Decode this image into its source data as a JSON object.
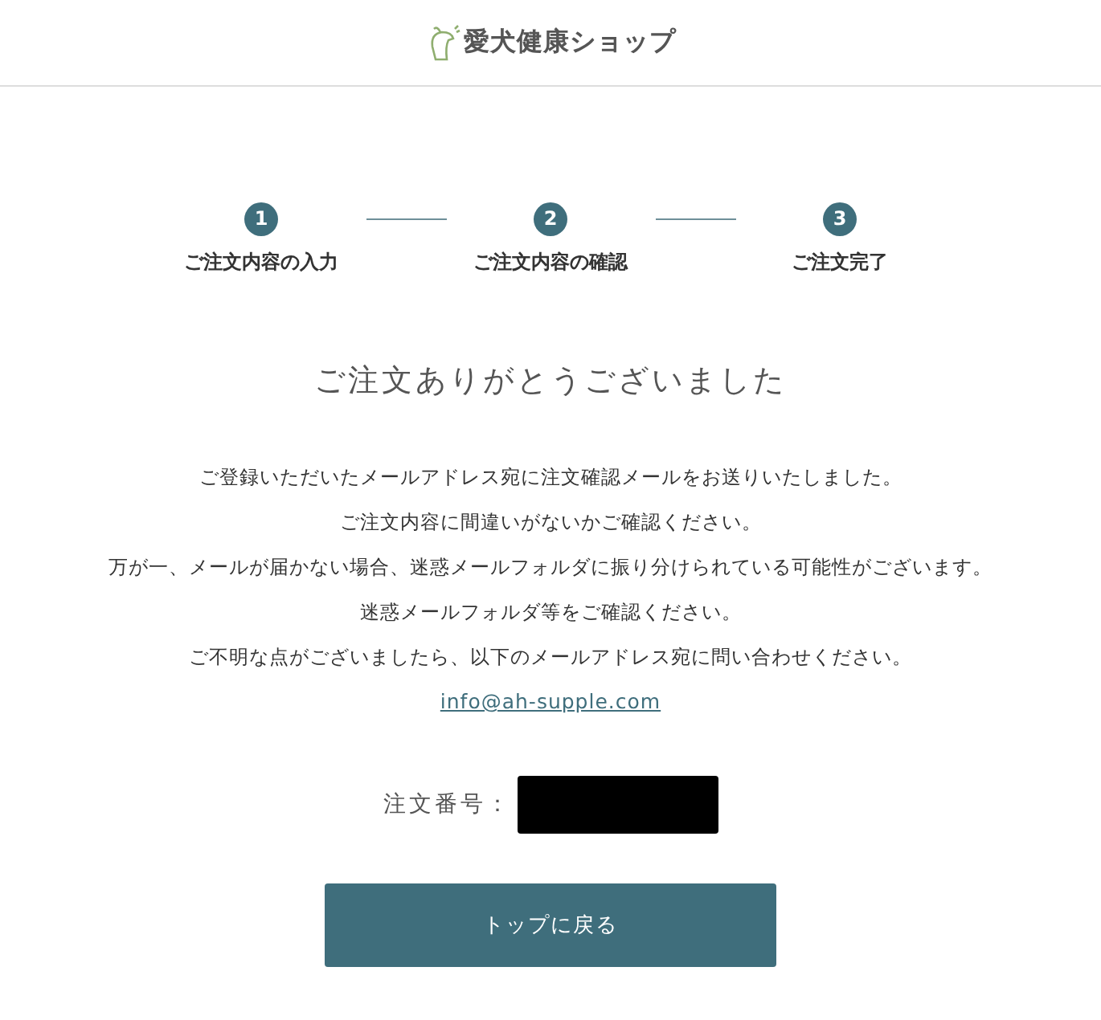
{
  "header": {
    "logo_text": "愛犬健康ショップ"
  },
  "steps": [
    {
      "number": "1",
      "label": "ご注文内容の入力"
    },
    {
      "number": "2",
      "label": "ご注文内容の確認"
    },
    {
      "number": "3",
      "label": "ご注文完了"
    }
  ],
  "title": "ご注文ありがとうございました",
  "message_lines": [
    "ご登録いただいたメールアドレス宛に注文確認メールをお送りいたしました。",
    "ご注文内容に間違いがないかご確認ください。",
    "万が一、メールが届かない場合、迷惑メールフォルダに振り分けられている可能性がございます。",
    "迷惑メールフォルダ等をご確認ください。",
    "ご不明な点がございましたら、以下のメールアドレス宛に問い合わせください。"
  ],
  "email_link": "info@ah-supple.com",
  "order_number": {
    "label": "注文番号："
  },
  "back_button": "トップに戻る"
}
